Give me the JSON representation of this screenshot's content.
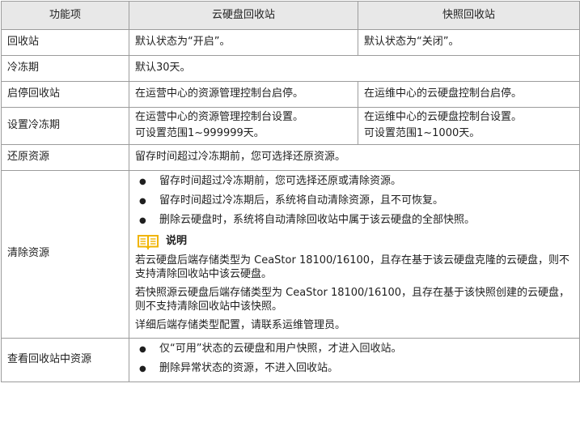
{
  "header": {
    "col1": "功能项",
    "col2": "云硬盘回收站",
    "col3": "快照回收站"
  },
  "rows": {
    "recycle": {
      "label": "回收站",
      "disk": "默认状态为“开启”。",
      "snapshot": "默认状态为“关闭”。"
    },
    "freeze": {
      "label": "冷冻期",
      "value": "默认30天。"
    },
    "toggle": {
      "label": "启停回收站",
      "disk": "在运营中心的资源管理控制台启停。",
      "snapshot": "在运维中心的云硬盘控制台启停。"
    },
    "freeze_setting": {
      "label": "设置冷冻期",
      "disk_line1": "在运营中心的资源管理控制台设置。",
      "disk_line2": "可设置范围1~999999天。",
      "snapshot_line1": "在运维中心的云硬盘控制台设置。",
      "snapshot_line2": "可设置范围1~1000天。"
    },
    "restore": {
      "label": "还原资源",
      "value": "留存时间超过冷冻期前，您可选择还原资源。"
    },
    "clear": {
      "label": "清除资源",
      "bullets": [
        "留存时间超过冷冻期前，您可选择还原或清除资源。",
        "留存时间超过冷冻期后，系统将自动清除资源，且不可恢复。",
        "删除云硬盘时，系统将自动清除回收站中属于该云硬盘的全部快照。"
      ],
      "note_title": "说明",
      "note_para1": "若云硬盘后端存储类型为 CeaStor 18100/16100，且存在基于该云硬盘克隆的云硬盘，则不支持清除回收站中该云硬盘。",
      "note_para2": "若快照源云硬盘后端存储类型为 CeaStor 18100/16100，且存在基于该快照创建的云硬盘，则不支持清除回收站中该快照。",
      "note_para3": "详细后端存储类型配置，请联系运维管理员。"
    },
    "view": {
      "label": "查看回收站中资源",
      "bullets": [
        "仅“可用”状态的云硬盘和用户快照，才进入回收站。",
        "删除异常状态的资源，不进入回收站。"
      ]
    }
  },
  "colors": {
    "header_bg": "#e8e8e8",
    "border": "#9c9c9c",
    "note_icon": "#f0b400"
  }
}
